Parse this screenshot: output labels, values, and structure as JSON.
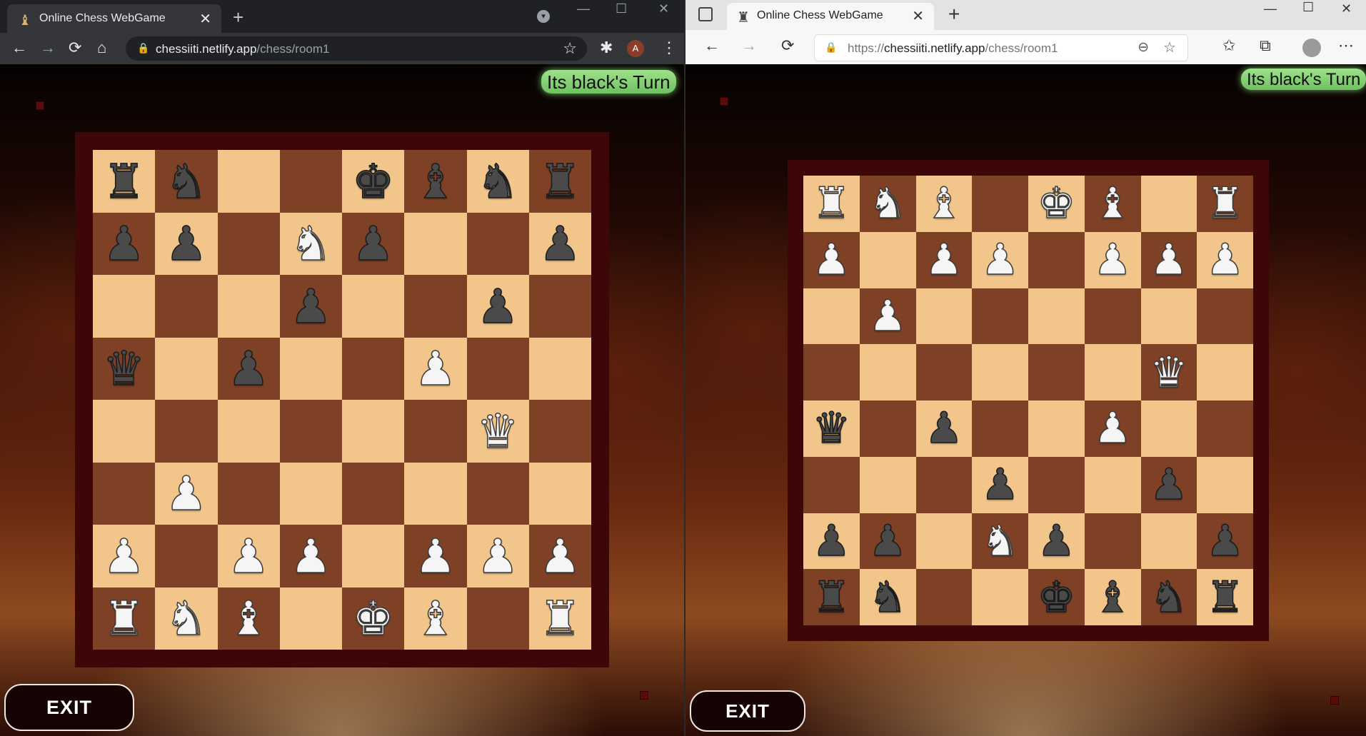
{
  "colors": {
    "light_square": "#f2c68a",
    "dark_square": "#7e4125",
    "board_frame": "#3e0707",
    "turn_badge": "#8fd67c"
  },
  "left_window": {
    "browser": "chrome",
    "tab": {
      "title": "Online Chess WebGame",
      "favicon": "chess-piece-icon",
      "close_glyph": "✕"
    },
    "new_tab_glyph": "+",
    "address": {
      "domain": "chessiiti.netlify.app",
      "path": "/chess/room1"
    },
    "profile_initial": "A",
    "icons": {
      "back": "←",
      "forward": "→",
      "reload": "⟳",
      "home": "⌂",
      "star": "☆",
      "extensions": "✱",
      "menu": "⋮",
      "lock": "🔒"
    },
    "window_controls": {
      "minimize": "—",
      "maximize": "☐",
      "close": "✕"
    },
    "game": {
      "turn_text": "Its black's Turn",
      "exit_label": "EXIT",
      "board_rows": [
        [
          "br",
          "bn",
          "",
          "",
          "bk",
          "bb",
          "bn",
          "br"
        ],
        [
          "bp",
          "bp",
          "",
          "wn",
          "bp",
          "",
          "",
          "bp"
        ],
        [
          "",
          "",
          "",
          "bp",
          "",
          "",
          "bp",
          ""
        ],
        [
          "bq",
          "",
          "bp",
          "",
          "",
          "wp",
          "",
          ""
        ],
        [
          "",
          "",
          "",
          "",
          "",
          "",
          "wq",
          ""
        ],
        [
          "",
          "wp",
          "",
          "",
          "",
          "",
          "",
          ""
        ],
        [
          "wp",
          "",
          "wp",
          "wp",
          "",
          "wp",
          "wp",
          "wp"
        ],
        [
          "wr",
          "wn",
          "wb",
          "",
          "wk",
          "wb",
          "",
          "wr"
        ]
      ]
    }
  },
  "right_window": {
    "browser": "edge",
    "tab": {
      "title": "Online Chess WebGame",
      "favicon": "chess-piece-icon",
      "close_glyph": "✕"
    },
    "new_tab_glyph": "+",
    "address": {
      "prefix": "https://",
      "domain": "chessiiti.netlify.app",
      "path": "/chess/room1"
    },
    "icons": {
      "back": "←",
      "forward": "→",
      "reload": "⟳",
      "zoom": "⊖",
      "add_favorite": "☆",
      "favorites": "✩",
      "collections": "⧉",
      "menu": "⋯",
      "lock": "🔒"
    },
    "window_controls": {
      "minimize": "—",
      "maximize": "☐",
      "close": "✕"
    },
    "game": {
      "turn_text": "Its black's Turn",
      "exit_label": "EXIT",
      "board_rows": [
        [
          "wr",
          "wn",
          "wb",
          "",
          "wk",
          "wb",
          "",
          "wr"
        ],
        [
          "wp",
          "",
          "wp",
          "wp",
          "",
          "wp",
          "wp",
          "wp"
        ],
        [
          "",
          "wp",
          "",
          "",
          "",
          "",
          "",
          ""
        ],
        [
          "",
          "",
          "",
          "",
          "",
          "",
          "wq",
          ""
        ],
        [
          "bq",
          "",
          "bp",
          "",
          "",
          "wp",
          "",
          ""
        ],
        [
          "",
          "",
          "",
          "bp",
          "",
          "",
          "bp",
          ""
        ],
        [
          "bp",
          "bp",
          "",
          "wn",
          "bp",
          "",
          "",
          "bp"
        ],
        [
          "br",
          "bn",
          "",
          "",
          "bk",
          "bb",
          "bn",
          "br"
        ]
      ]
    }
  }
}
